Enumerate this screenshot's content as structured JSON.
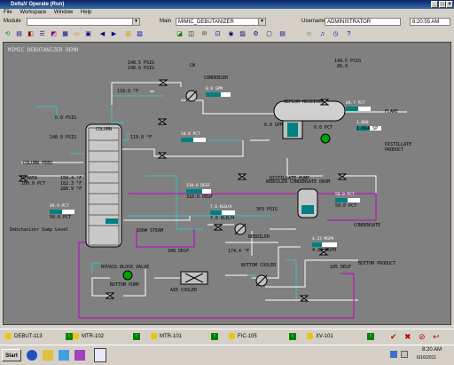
{
  "window": {
    "title": "DeltaV Operate (Run)"
  },
  "menu": [
    "File",
    "Workspace",
    "Window",
    "Help"
  ],
  "header": {
    "module_label": "Module",
    "main_label": "Main",
    "main_value": "MIMIC_DEBUTANIZER",
    "username_label": "Username",
    "username_value": "ADMINISTRATOR",
    "clock": "8:20:55 AM"
  },
  "display": {
    "title": "MIMIC DEBUTANIZER DEMO",
    "labels": {
      "condenser": "CONDENSER",
      "reflux_receiver": "REFLUX RECEIVER",
      "flare": "FLARE",
      "column": "COLUMN",
      "column_feed": "COLUMN FEED",
      "distillate_pump": "DISTILLATE PUMP",
      "distillate_product": "DISTILLATE PRODUCT",
      "reboiler_drum": "REBOILER CONDENSATE DRUM",
      "condensate": "CONDENSATE",
      "reboiler": "REBOILER",
      "sump_level": "Debutanizer Sump Level",
      "steam": "100# STEAM",
      "bypass_valve": "BYPASS BLOCK VALVE",
      "bottom_pump": "BOTTOM PUMP",
      "air_cooler": "AIR COOLER",
      "bottom_cooler": "BOTTOM COOLER",
      "bottom_product": "BOTTOM PRODUCT",
      "cw": "CW"
    },
    "values": {
      "cond_top_pv": "148.5 PSIG",
      "cond_top_sp": "148.0 PSIG",
      "cond_temp": "118.0 °F",
      "recv_pressure_pv": "148.5 PSIG",
      "recv_pressure_sp": "80.0",
      "recv_level_pv": "49.7 PCT",
      "recv_level_sp": "50.0 PCT",
      "reflux_flow_pv": "0.0 GPM",
      "reflux_flow_sp": "0.0 GPM",
      "dist_flow_pv": "1,000",
      "dist_flow_sp": "1.014 SP",
      "dist_pct": "0.0 PCT",
      "col_psig": "0.0 PSIG",
      "col_top_press": "148.0 PSIG",
      "col_temp_top": "119.0 °F",
      "col_temp_b": "158.4 °F",
      "col_temp_c": "182.3 °F",
      "col_temp_d": "288.9 °F",
      "feed_flow": "0.0659",
      "feed_pct": "100.0 PCT",
      "steam_temp_pv": "310.0 DEGF",
      "steam_temp_sp": "310.0 DEGF",
      "steam_flow_pv": "7.6 KLB/H",
      "steam_flow_sp": "7.6 KLB/H",
      "sump_level_pv": "49.9 PCT",
      "sump_level_sp": "50.0 PCT",
      "drum_level_pv": "50.0 PCT",
      "drum_level_sp": "50.0 PCT",
      "drum_press": "303 PSIG",
      "bottom_flow_pv": "4.23 MGPH",
      "bottom_flow_sp": "4.23 MGPH",
      "air_temp": "348 DEGF",
      "cooler_temp": "174.4 °F",
      "bottom_temp": "105 DEGF"
    }
  },
  "status_alarms": [
    {
      "tag": "DEBUT-113"
    },
    {
      "tag": "MTR-102"
    },
    {
      "tag": "MTR-101"
    },
    {
      "tag": "FIC-105"
    },
    {
      "tag": "XV-101"
    }
  ],
  "status_right": {
    "area": "DEBUT-113"
  },
  "taskbar": {
    "start": "Start",
    "time": "8:20 AM",
    "date": "6/16/2011"
  },
  "colors": {
    "pipe_cyan": "#40c0c0",
    "pipe_white": "#ffffff",
    "pipe_magenta": "#c000c0",
    "teal_bar": "#008080",
    "canvas_bg": "#808080"
  }
}
